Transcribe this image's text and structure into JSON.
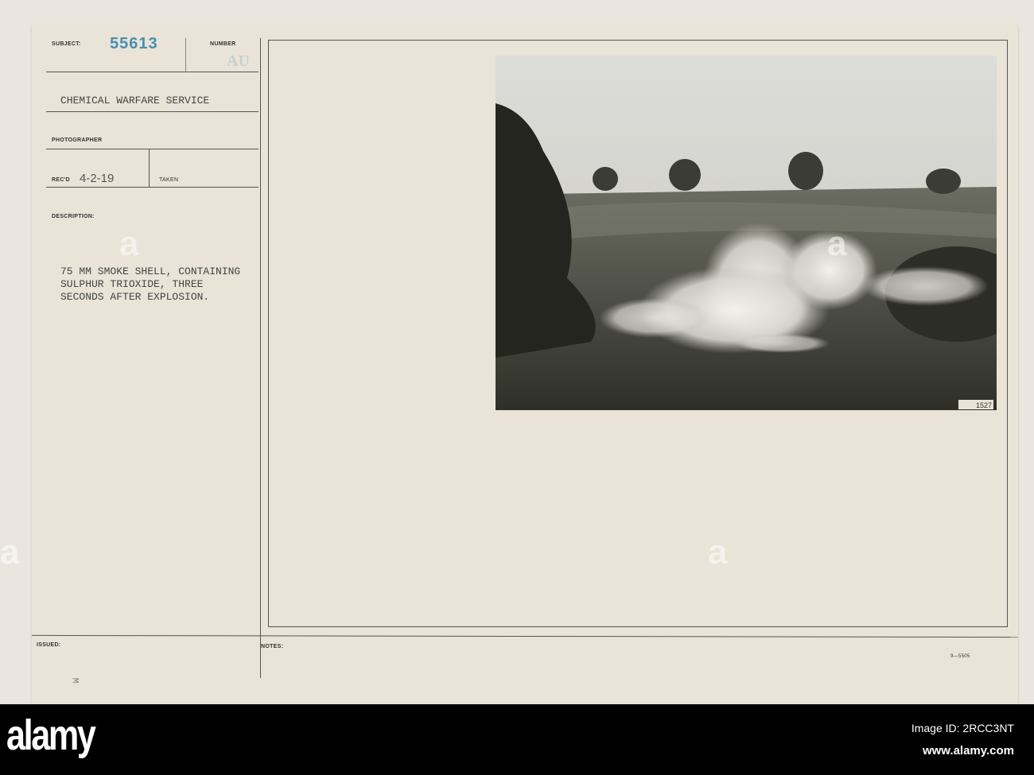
{
  "card": {
    "subject_label": "SUBJECT:",
    "subject_number": "55613",
    "number_label": "NUMBER",
    "number_value": "AU",
    "agency": "CHEMICAL WARFARE SERVICE",
    "photographer_label": "PHOTOGRAPHER",
    "recd_label": "REC'D",
    "recd_value": "4-2-19",
    "taken_label": "TAKEN",
    "description_label": "DESCRIPTION:",
    "description_lines": [
      "75 MM SMOKE SHELL, CONTAINING",
      "SULPHUR TRIOXIDE, THREE",
      "SECONDS AFTER EXPLOSION."
    ],
    "issued_label": "ISSUED:",
    "issued_mark": "M",
    "notes_label": "NOTES:",
    "form_number": "9—5505",
    "photo_number": "1527"
  },
  "watermark": {
    "logo": "alamy",
    "image_id": "Image ID: 2RCC3NT",
    "url": "www.alamy.com"
  },
  "colors": {
    "stamp_blue": "#4a8fb0",
    "card": "#e9e3d8"
  }
}
